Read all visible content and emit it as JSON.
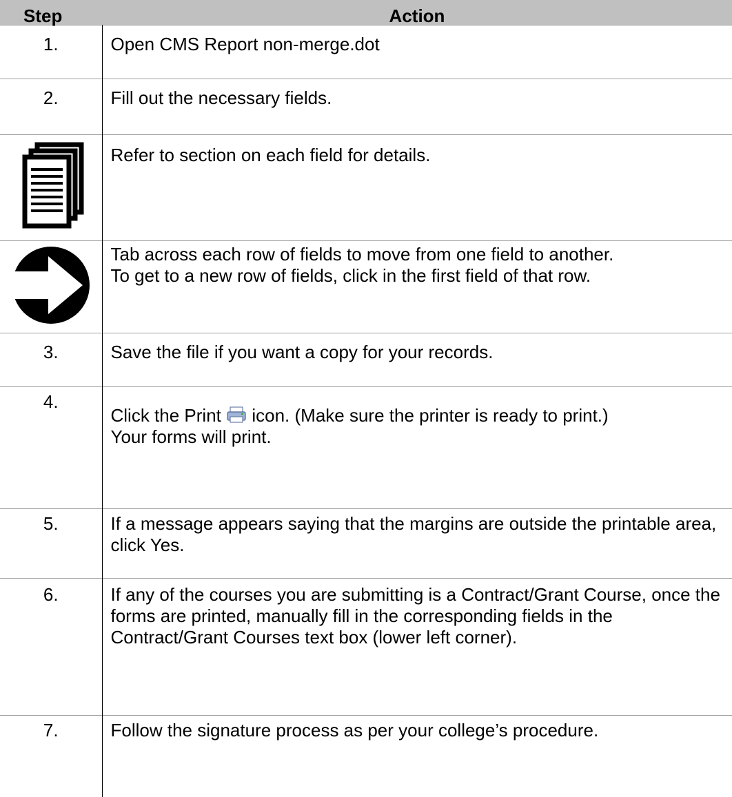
{
  "header": {
    "step": "Step",
    "action": "Action"
  },
  "rows": [
    {
      "step": "1.",
      "lines": [
        "Open CMS Report non-merge.dot"
      ]
    },
    {
      "step": "2.",
      "lines": [
        "Fill out the necessary fields."
      ]
    },
    {
      "icon": "documents-icon",
      "lines": [
        "Refer to section on each field for details."
      ]
    },
    {
      "icon": "arrow-right-icon",
      "lines": [
        "Tab across each row of fields to move from one field to another.",
        "To get to a new row of fields, click in the first field of that row."
      ]
    },
    {
      "step": "3.",
      "lines": [
        "Save the file if you want a copy for your records."
      ]
    },
    {
      "step": "4.",
      "print_before": "Click the Print",
      "print_after": "icon. (Make sure the printer is ready to print.)",
      "lines": [
        "Your forms will print."
      ]
    },
    {
      "step": "5.",
      "lines": [
        "If a message appears saying that the margins are outside the printable area, click Yes."
      ]
    },
    {
      "step": "6.",
      "lines": [
        "If any of the courses you are submitting is a Contract/Grant Course, once the forms are printed, manually fill in the corresponding fields in the Contract/Grant Courses text box (lower left corner)."
      ]
    },
    {
      "step": "7.",
      "lines": [
        "Follow the signature process as per your college’s procedure."
      ]
    }
  ],
  "colors": {
    "header_bg": "#c0c0c0",
    "row_rule": "#a0a0a0"
  }
}
